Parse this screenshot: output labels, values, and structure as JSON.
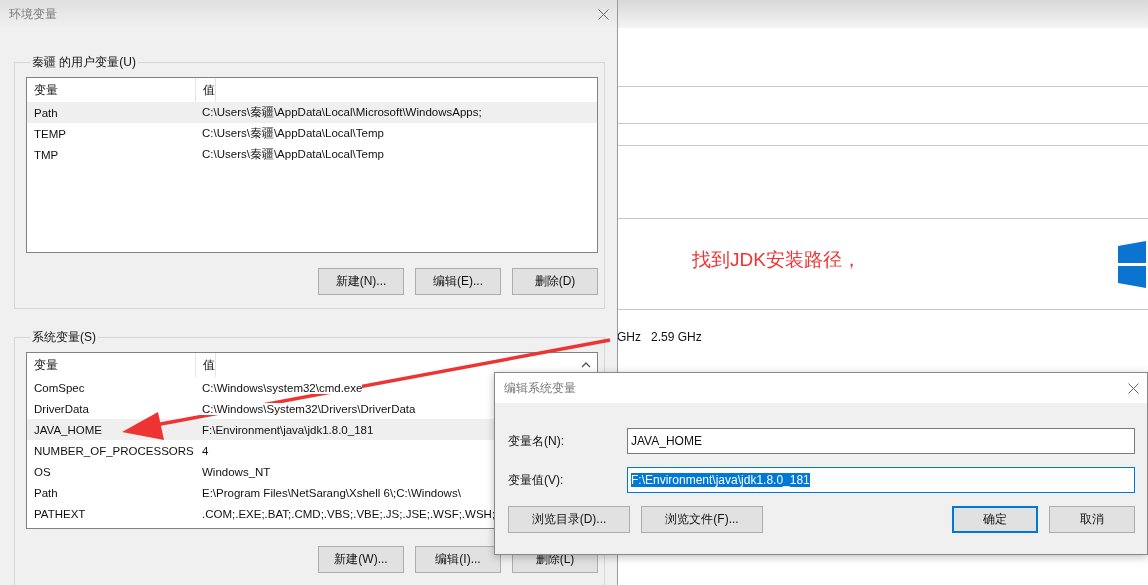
{
  "background_window": {
    "texts": [
      "GHz",
      "2.59 GHz"
    ]
  },
  "annotation": {
    "text": "找到JDK安装路径，"
  },
  "env_dialog": {
    "title": "环境变量",
    "user_group": {
      "label": "秦疆 的用户变量(U)",
      "columns": [
        "变量",
        "值"
      ],
      "rows": [
        {
          "name": "Path",
          "value": "C:\\Users\\秦疆\\AppData\\Local\\Microsoft\\WindowsApps;",
          "selected": true
        },
        {
          "name": "TEMP",
          "value": "C:\\Users\\秦疆\\AppData\\Local\\Temp",
          "selected": false
        },
        {
          "name": "TMP",
          "value": "C:\\Users\\秦疆\\AppData\\Local\\Temp",
          "selected": false
        }
      ],
      "buttons": [
        "新建(N)...",
        "编辑(E)...",
        "删除(D)"
      ]
    },
    "system_group": {
      "label": "系统变量(S)",
      "columns": [
        "变量",
        "值"
      ],
      "rows": [
        {
          "name": "ComSpec",
          "value": "C:\\Windows\\system32\\cmd.exe",
          "selected": false
        },
        {
          "name": "DriverData",
          "value": "C:\\Windows\\System32\\Drivers\\DriverData",
          "selected": false
        },
        {
          "name": "JAVA_HOME",
          "value": "F:\\Environment\\java\\jdk1.8.0_181",
          "selected": true
        },
        {
          "name": "NUMBER_OF_PROCESSORS",
          "value": "4",
          "selected": false
        },
        {
          "name": "OS",
          "value": "Windows_NT",
          "selected": false
        },
        {
          "name": "Path",
          "value": "E:\\Program Files\\NetSarang\\Xshell 6\\;C:\\Windows\\",
          "selected": false
        },
        {
          "name": "PATHEXT",
          "value": ".COM;.EXE;.BAT;.CMD;.VBS;.VBE;.JS;.JSE;.WSF;.WSH;",
          "selected": false
        }
      ],
      "buttons": [
        "新建(W)...",
        "编辑(I)...",
        "删除(L)"
      ]
    }
  },
  "edit_dialog": {
    "title": "编辑系统变量",
    "fields": [
      {
        "label": "变量名(N):",
        "value": "JAVA_HOME",
        "text_selected": false
      },
      {
        "label": "变量值(V):",
        "value": "F:\\Environment\\java\\jdk1.8.0_181",
        "text_selected": true
      }
    ],
    "browse_buttons": [
      "浏览目录(D)...",
      "浏览文件(F)..."
    ],
    "buttons": [
      {
        "label": "确定",
        "default": true
      },
      {
        "label": "取消",
        "default": false
      }
    ]
  }
}
